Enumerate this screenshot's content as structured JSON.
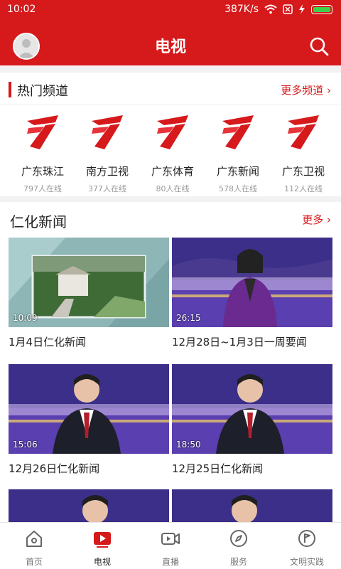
{
  "status": {
    "time": "10:02",
    "speed": "387K/s"
  },
  "header": {
    "title": "电视"
  },
  "hot": {
    "label": "热门频道",
    "more": "更多频道 ›",
    "channels": [
      {
        "name": "广东珠江",
        "online": "797人在线"
      },
      {
        "name": "南方卫视",
        "online": "377人在线"
      },
      {
        "name": "广东体育",
        "online": "80人在线"
      },
      {
        "name": "广东新闻",
        "online": "578人在线"
      },
      {
        "name": "广东卫视",
        "online": "112人在线"
      }
    ]
  },
  "news": {
    "label": "仁化新闻",
    "more": "更多 ›",
    "items": [
      {
        "duration": "10:09",
        "title": "1月4日仁化新闻"
      },
      {
        "duration": "26:15",
        "title": "12月28日~1月3日一周要闻"
      },
      {
        "duration": "15:06",
        "title": "12月26日仁化新闻"
      },
      {
        "duration": "18:50",
        "title": "12月25日仁化新闻"
      }
    ]
  },
  "tabs": [
    {
      "label": "首页"
    },
    {
      "label": "电视"
    },
    {
      "label": "直播"
    },
    {
      "label": "服务"
    },
    {
      "label": "文明实践"
    }
  ],
  "colors": {
    "brand": "#d6191b",
    "tab_active": "#d6191b"
  }
}
